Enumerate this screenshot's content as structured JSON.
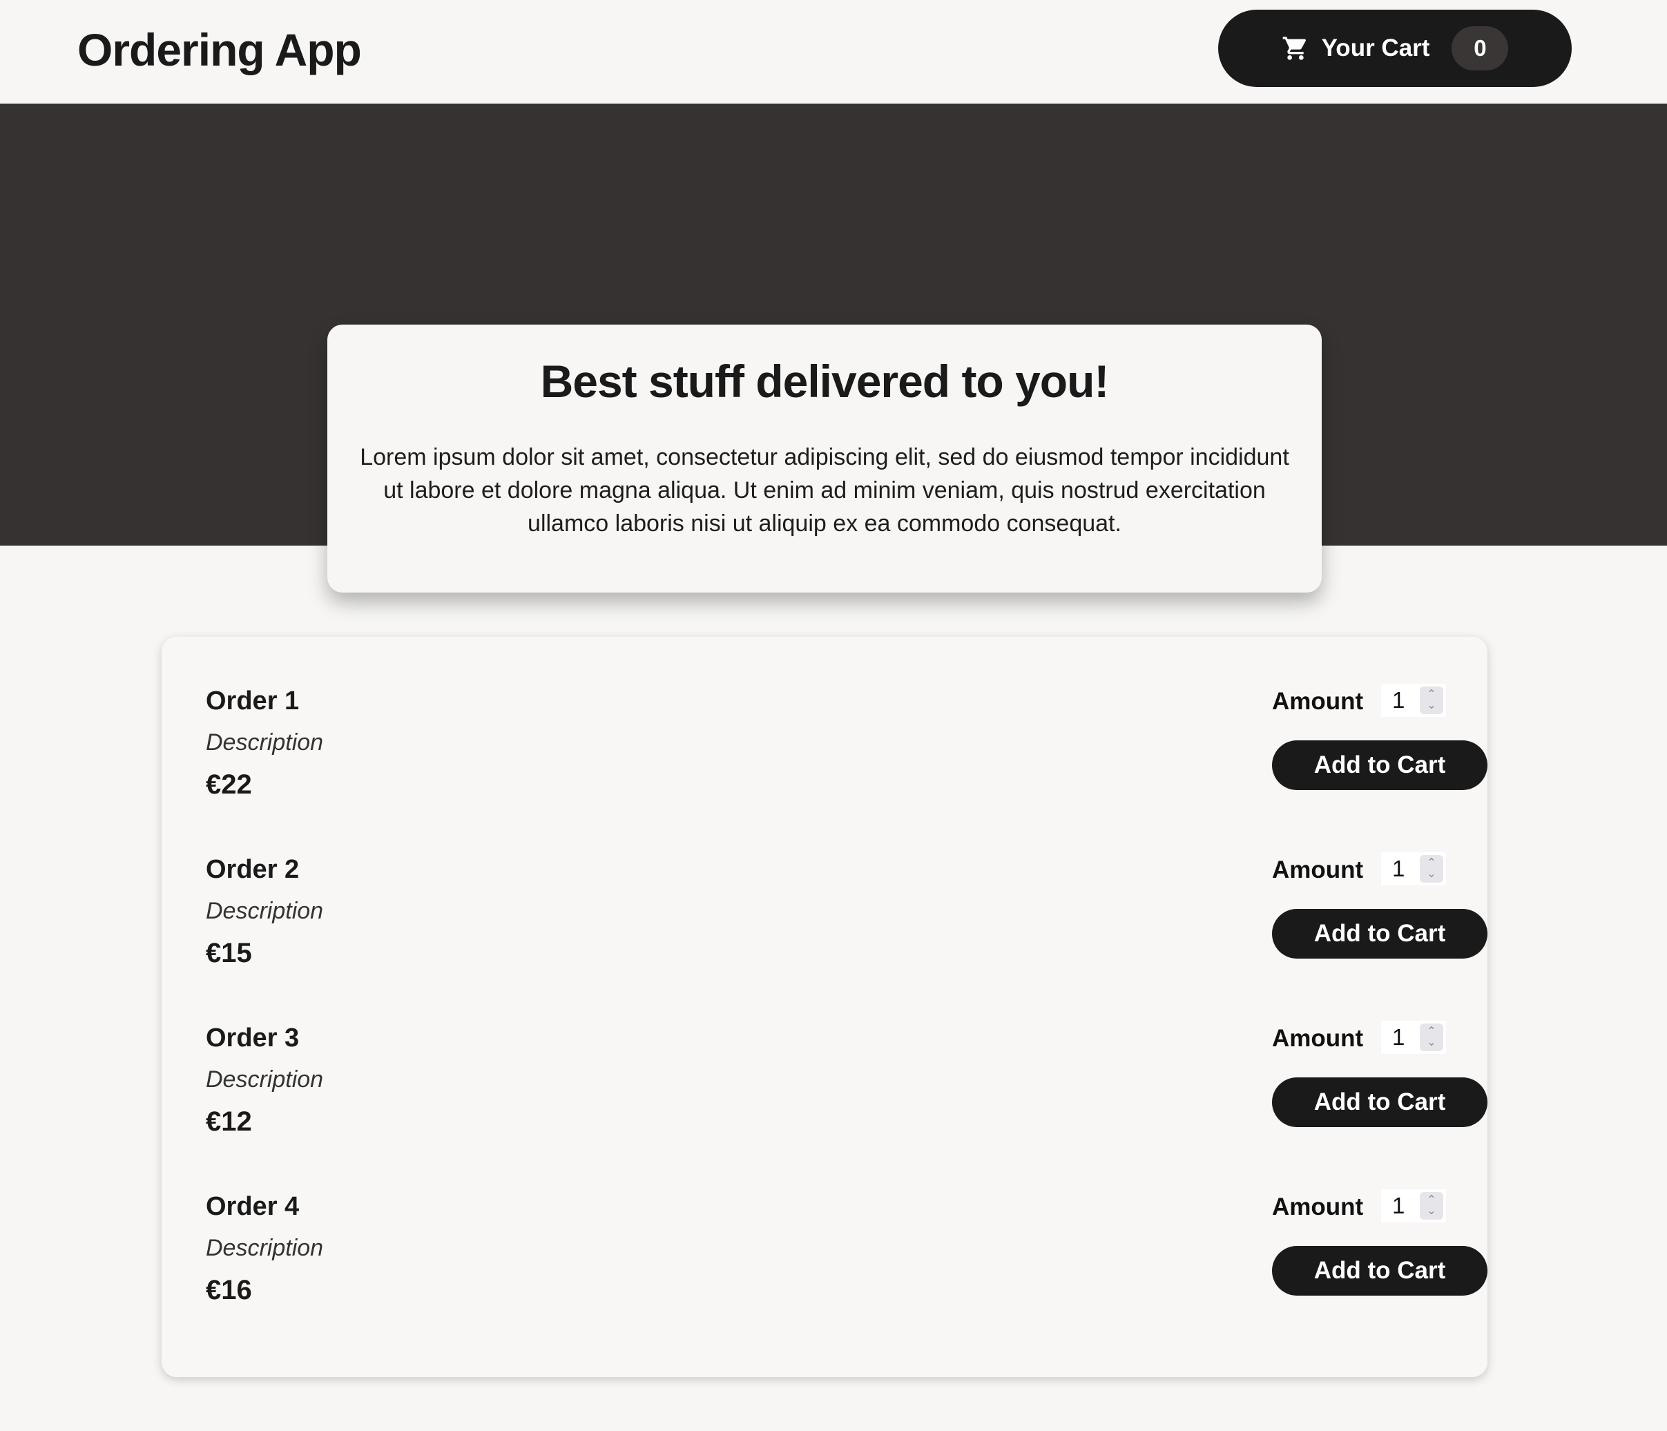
{
  "header": {
    "app_title": "Ordering App",
    "cart_label": "Your Cart",
    "cart_count": "0",
    "cart_icon": "cart-icon"
  },
  "summary": {
    "title": "Best stuff delivered to you!",
    "text": "Lorem ipsum dolor sit amet, consectetur adipiscing elit, sed do eiusmod tempor incididunt ut labore et dolore magna aliqua. Ut enim ad minim veniam, quis nostrud exercitation ullamco laboris nisi ut aliquip ex ea commodo consequat."
  },
  "orders": [
    {
      "name": "Order 1",
      "description": "Description",
      "price": "€22",
      "amount_label": "Amount",
      "amount": "1",
      "button": "Add to Cart"
    },
    {
      "name": "Order 2",
      "description": "Description",
      "price": "€15",
      "amount_label": "Amount",
      "amount": "1",
      "button": "Add to Cart"
    },
    {
      "name": "Order 3",
      "description": "Description",
      "price": "€12",
      "amount_label": "Amount",
      "amount": "1",
      "button": "Add to Cart"
    },
    {
      "name": "Order 4",
      "description": "Description",
      "price": "€16",
      "amount_label": "Amount",
      "amount": "1",
      "button": "Add to Cart"
    }
  ],
  "colors": {
    "background": "#f7f6f4",
    "hero": "#373232",
    "button": "#1b1a1a",
    "badge": "#3a3636"
  }
}
